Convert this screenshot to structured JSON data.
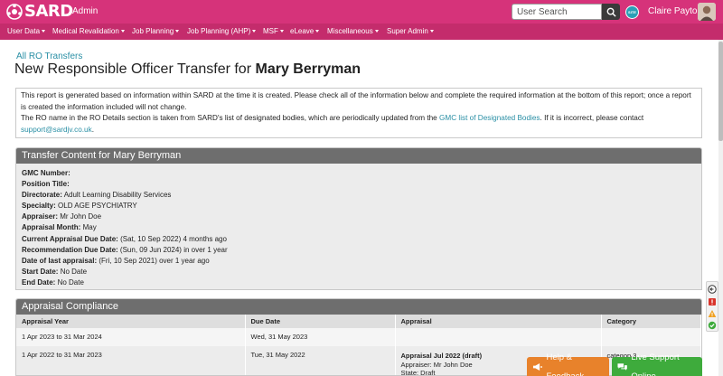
{
  "header": {
    "logo_text": "SARD",
    "admin_label": "Admin",
    "search_placeholder": "User Search",
    "site_badge": "SITE",
    "user_name": "Claire Payton"
  },
  "nav": {
    "items": [
      {
        "label": "User Data"
      },
      {
        "label": "Medical Revalidation"
      },
      {
        "label": "Job Planning"
      },
      {
        "label": "Job Planning (AHP)"
      },
      {
        "label": "MSF"
      },
      {
        "label": "eLeave"
      },
      {
        "label": "Miscellaneous"
      },
      {
        "label": "Super Admin"
      }
    ]
  },
  "breadcrumb": "All RO Transfers",
  "page_title": {
    "prefix": "New Responsible Officer Transfer for ",
    "name": "Mary Berryman"
  },
  "notice": {
    "line1": "This report is generated based on information within SARD at the time it is created. Please check all of the information below and complete the required information at the bottom of this report; once a report is created the information included will not change.",
    "line2_part1": "The RO name in the RO Details section is taken from SARD's list of designated bodies, which are periodically updated from the ",
    "line2_link": "GMC list of Designated Bodies",
    "line2_part2": ". If it is incorrect, please contact ",
    "email": "support@sardjv.co.uk",
    "line2_end": "."
  },
  "transfer": {
    "title": "Transfer Content for Mary Berryman",
    "fields": [
      {
        "label": "GMC Number:",
        "value": ""
      },
      {
        "label": "Position Title:",
        "value": ""
      },
      {
        "label": "Directorate:",
        "value": "Adult Learning Disability Services"
      },
      {
        "label": "Specialty:",
        "value": "OLD AGE PSYCHIATRY"
      },
      {
        "label": "Appraiser:",
        "value": "Mr John Doe"
      },
      {
        "label": "Appraisal Month:",
        "value": "May"
      },
      {
        "label": "Current Appraisal Due Date:",
        "value": "(Sat, 10 Sep 2022) 4 months ago"
      },
      {
        "label": "Recommendation Due Date:",
        "value": "(Sun, 09 Jun 2024) in over 1 year"
      },
      {
        "label": "Date of last appraisal:",
        "value": "(Fri, 10 Sep 2021) over 1 year ago"
      },
      {
        "label": "Start Date:",
        "value": "No Date"
      },
      {
        "label": "End Date:",
        "value": "No Date"
      }
    ]
  },
  "compliance": {
    "title": "Appraisal Compliance",
    "columns": [
      "Appraisal Year",
      "Due Date",
      "Appraisal",
      "Category"
    ],
    "rows": [
      {
        "year": "1 Apr 2023 to 31 Mar 2024",
        "due": "Wed, 31 May 2023",
        "appraisal_title": "",
        "appraiser": "",
        "state": "",
        "category": ""
      },
      {
        "year": "1 Apr 2022 to 31 Mar 2023",
        "due": "Tue, 31 May 2022",
        "appraisal_title": "Appraisal Jul 2022 (draft)",
        "appraiser": "Appraiser: Mr John Doe",
        "state": "State: Draft",
        "category": "category3"
      }
    ]
  },
  "footer": {
    "help_label": "Help & Feedback",
    "live_label": "Live Support Online"
  }
}
